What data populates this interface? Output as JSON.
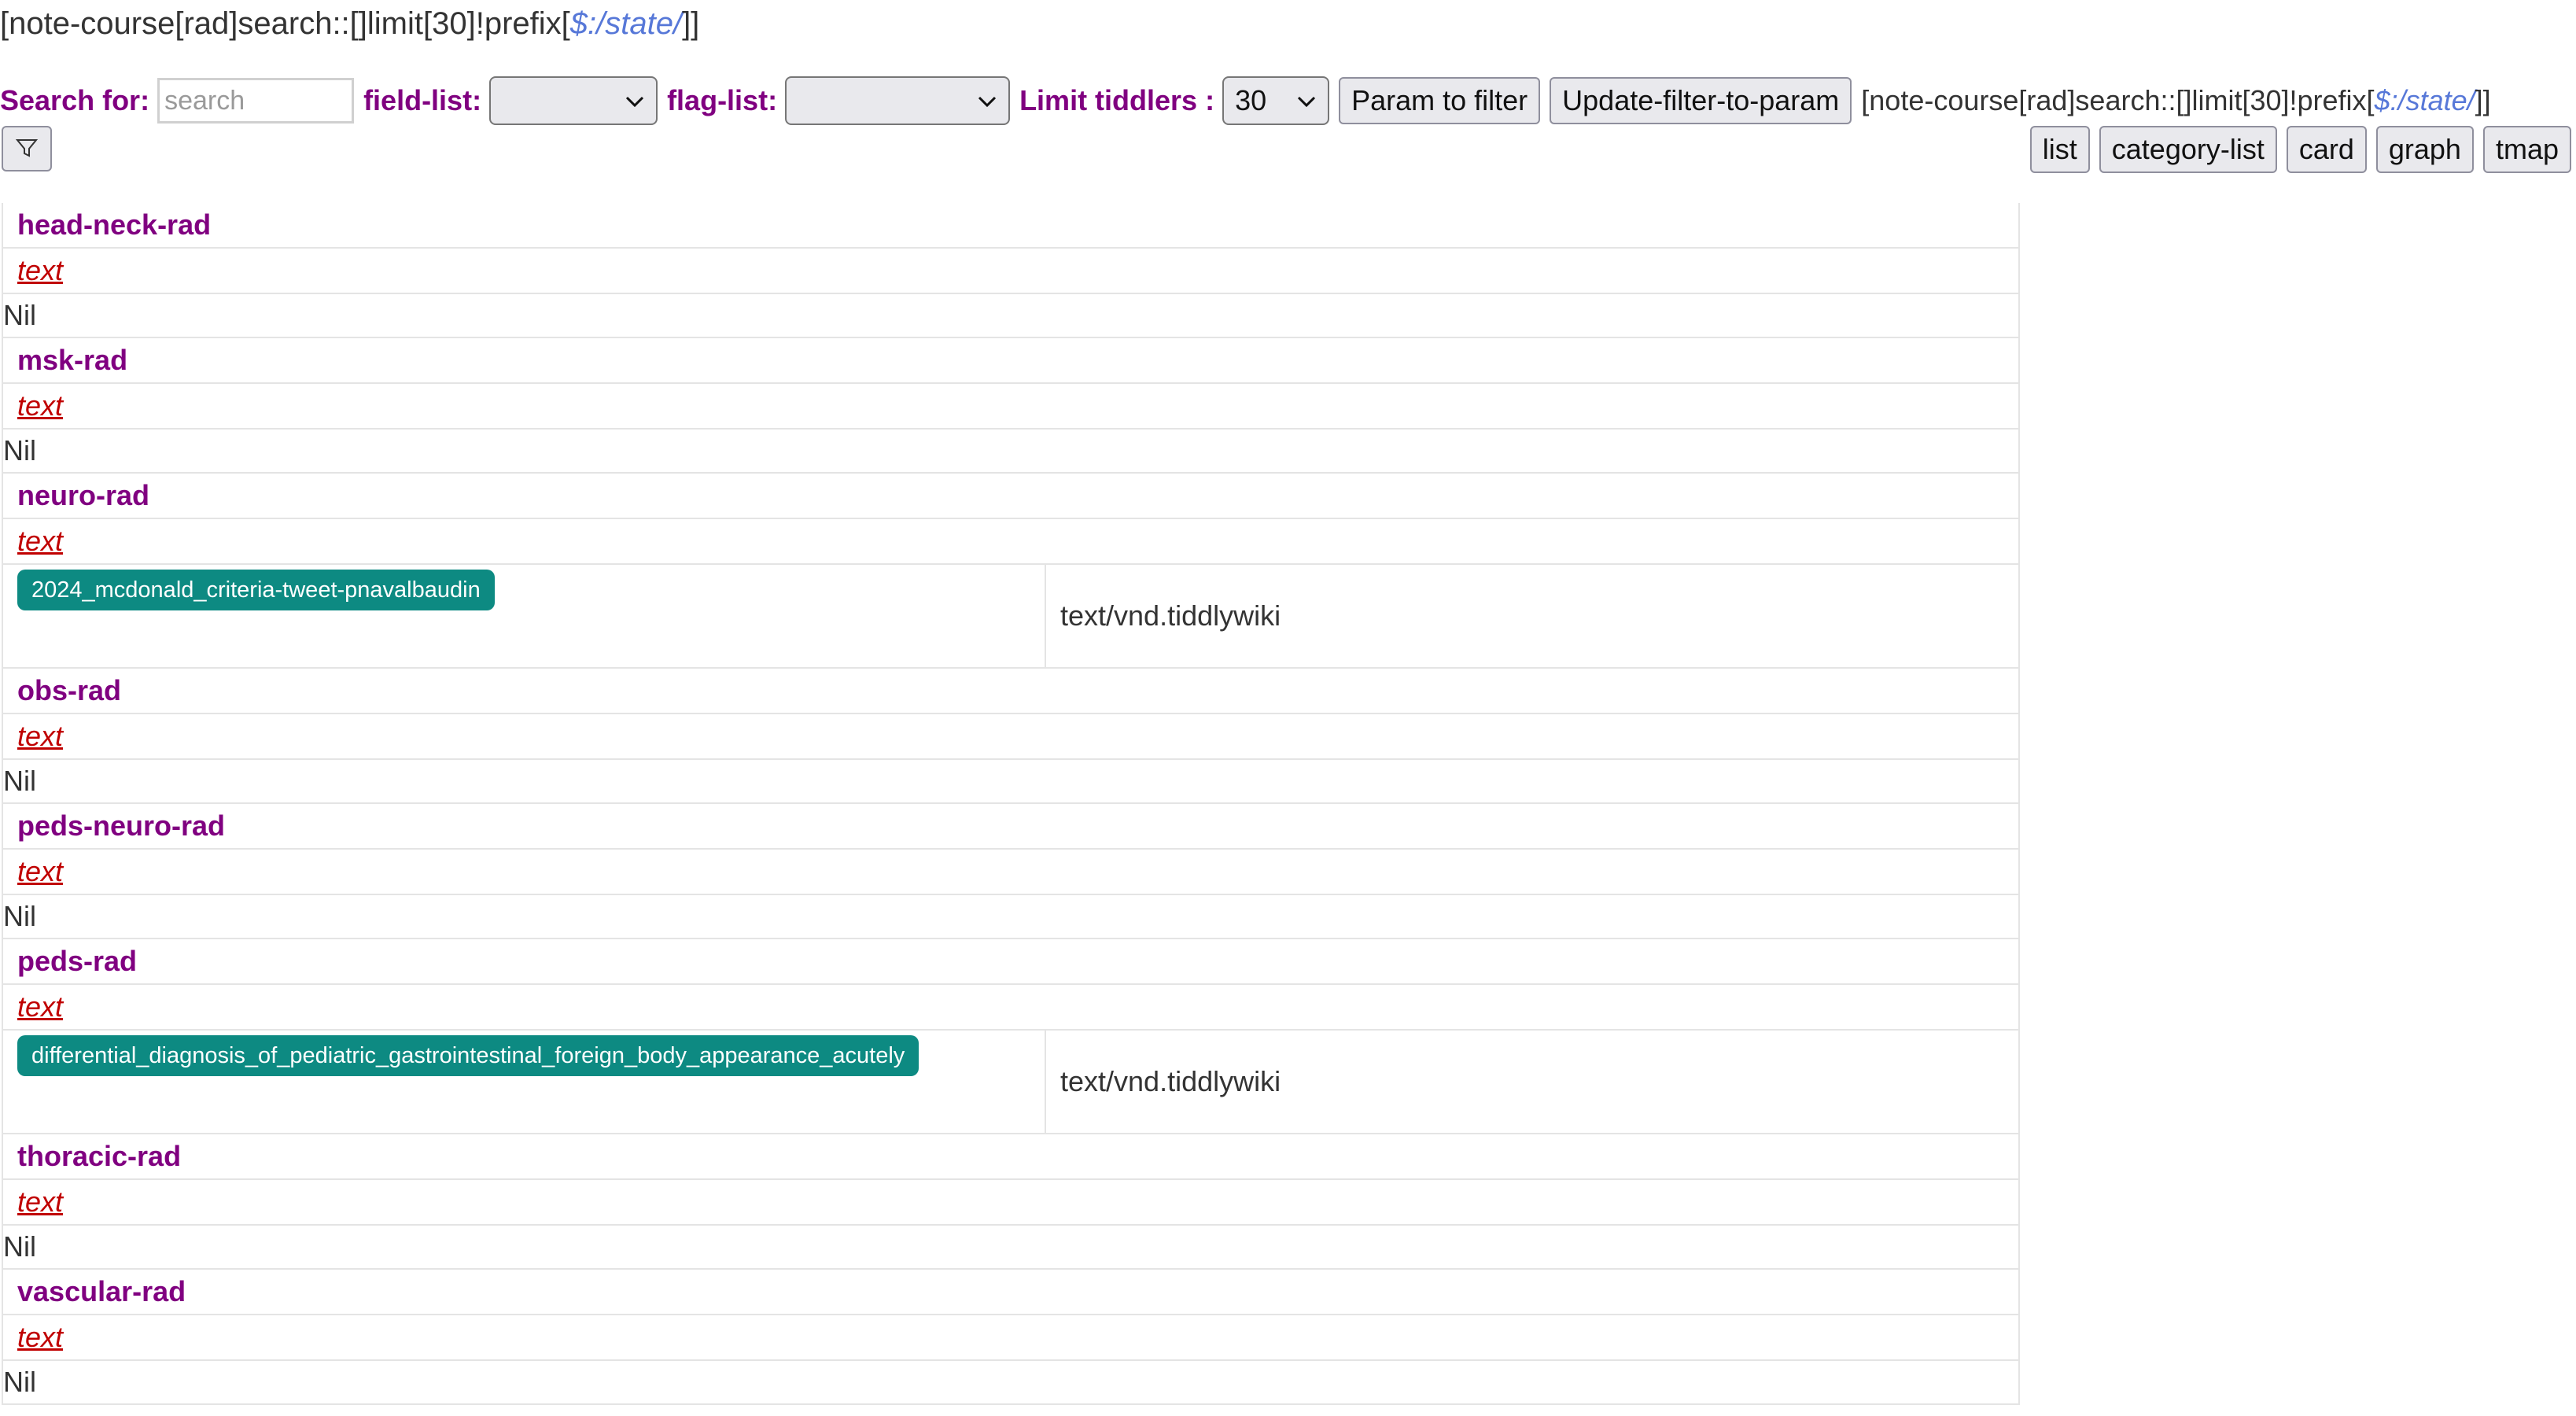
{
  "filter_title": {
    "prefix": "[note-course[rad]search::[]limit[30]!prefix[",
    "link": "$:/state/",
    "suffix": "]]"
  },
  "toolbar": {
    "search_label": "Search for:",
    "search_placeholder": "search",
    "search_value": "",
    "field_list_label": "field-list:",
    "field_list_value": "",
    "flag_list_label": "flag-list:",
    "flag_list_value": "",
    "limit_label": "Limit tiddlers :",
    "limit_value": "30",
    "param_to_filter_label": "Param to filter",
    "update_filter_label": "Update-filter-to-param",
    "filter_text_prefix": "[note-course[rad]search::[]limit[30]!prefix[",
    "filter_text_link": "$:/state/",
    "filter_text_suffix": "]]"
  },
  "view_buttons": {
    "list": "list",
    "category_list": "category-list",
    "card": "card",
    "graph": "graph",
    "tmap": "tmap"
  },
  "icons": {
    "filter": "funnel-icon",
    "dropdown": "chevron-down-icon"
  },
  "colors": {
    "category": "#800080",
    "missing_link": "#c00000",
    "pill_bg": "#0d8a82",
    "state_link": "#5778d8"
  },
  "categories": [
    {
      "name": "head-neck-rad",
      "field": "text",
      "nil": "Nil"
    },
    {
      "name": "msk-rad",
      "field": "text",
      "nil": "Nil"
    },
    {
      "name": "neuro-rad",
      "field": "text",
      "entry": {
        "title": "2024_mcdonald_criteria-tweet-pnavalbaudin",
        "type": "text/vnd.tiddlywiki"
      }
    },
    {
      "name": "obs-rad",
      "field": "text",
      "nil": "Nil"
    },
    {
      "name": "peds-neuro-rad",
      "field": "text",
      "nil": "Nil"
    },
    {
      "name": "peds-rad",
      "field": "text",
      "entry": {
        "title": "differential_diagnosis_of_pediatric_gastrointestinal_foreign_body_appearance_acutely",
        "type": "text/vnd.tiddlywiki"
      }
    },
    {
      "name": "thoracic-rad",
      "field": "text",
      "nil": "Nil"
    },
    {
      "name": "vascular-rad",
      "field": "text",
      "nil": "Nil"
    }
  ]
}
